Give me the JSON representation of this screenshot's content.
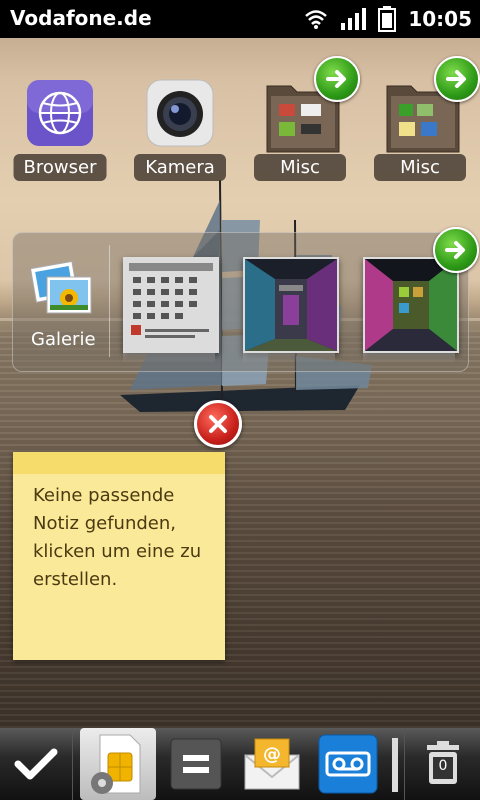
{
  "status_bar": {
    "carrier": "Vodafone.de",
    "time": "10:05",
    "icons": [
      "wifi-icon",
      "signal-icon",
      "battery-icon"
    ]
  },
  "apps": [
    {
      "label": "Browser",
      "icon": "globe-icon"
    },
    {
      "label": "Kamera",
      "icon": "camera-icon"
    },
    {
      "label": "Misc",
      "icon": "folder-icon"
    },
    {
      "label": "Misc",
      "icon": "folder-icon"
    }
  ],
  "gallery": {
    "label": "Galerie",
    "icon": "photos-icon"
  },
  "note": {
    "text": "Keine passende Notiz gefunden, klicken um eine zu erstellen."
  },
  "dock": {
    "trash_count": "0",
    "items": [
      "checkmark-icon",
      "sim-settings-icon",
      "calculator-icon",
      "email-icon",
      "voicemail-icon",
      "trash-icon"
    ]
  },
  "colors": {
    "accent_green": "#2d9a17",
    "close_red": "#c8201b",
    "note_yellow": "#fbe99a",
    "voicemail_blue": "#1a7fd8"
  }
}
